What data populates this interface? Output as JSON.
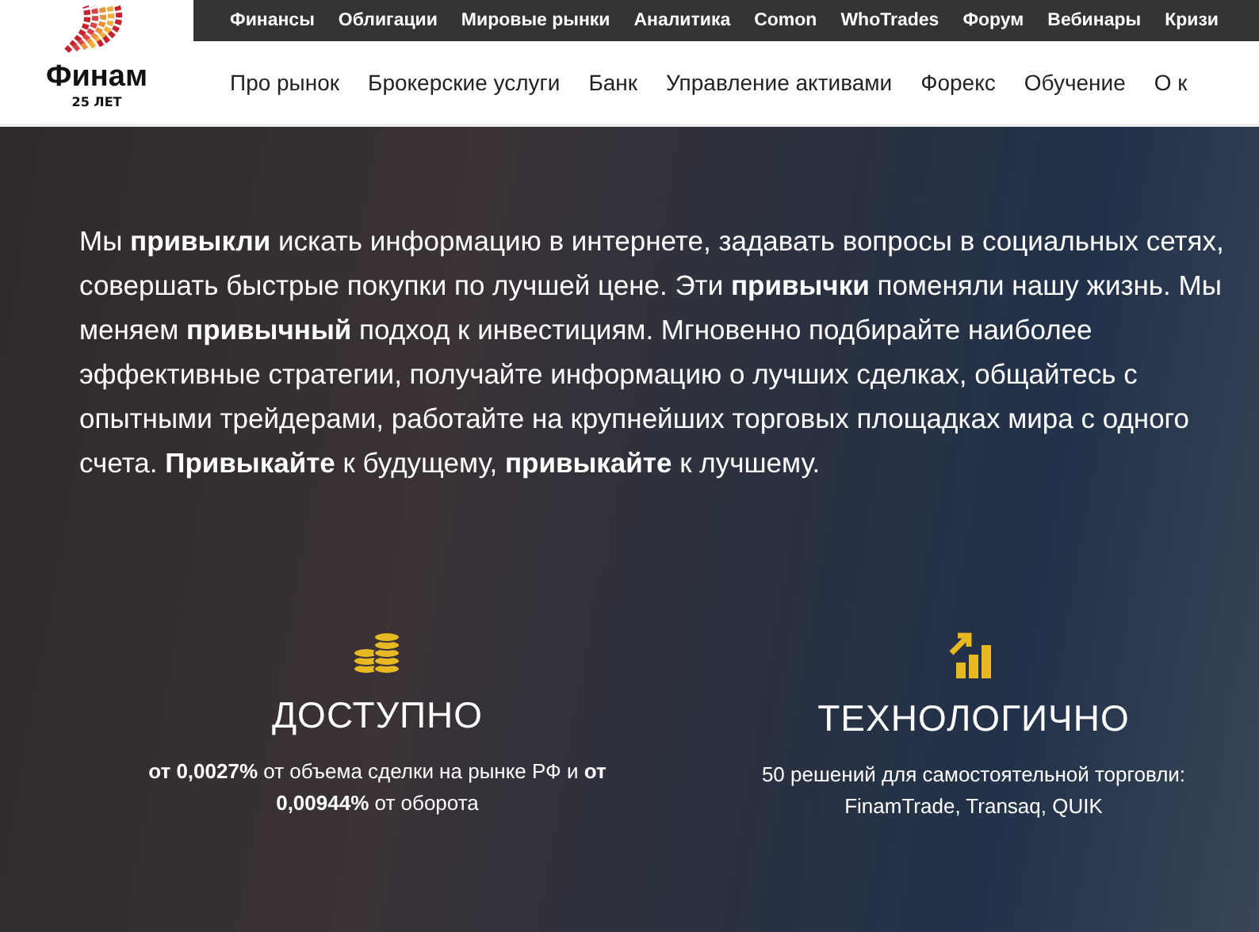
{
  "logo": {
    "name": "Финам",
    "tagline": "25 ЛЕТ"
  },
  "top_nav": [
    "Финансы",
    "Облигации",
    "Мировые рынки",
    "Аналитика",
    "Comon",
    "WhoTrades",
    "Форум",
    "Вебинары",
    "Кризи"
  ],
  "main_nav": [
    "Про рынок",
    "Брокерские услуги",
    "Банк",
    "Управление активами",
    "Форекс",
    "Обучение",
    "О к"
  ],
  "intro": "Мы **привыкли** искать информацию в интернете, задавать вопросы в социальных сетях, совершать быстрые покупки по лучшей цене. Эти **привычки** поменяли нашу жизнь. Мы меняем **привычный** подход к инвестициям. Мгновенно подбирайте наиболее эффективные стратегии, получайте информацию о лучших сделках, общайтесь с опытными трейдерами, работайте на крупнейших торговых площадках мира с одного счета. **Привыкайте** к будущему, **привыкайте** к лучшему.",
  "features": [
    {
      "kind": "coins",
      "title": "ДОСТУПНО",
      "text": "**от 0,0027%** от объема сделки на рынке РФ и **от 0,00944%** от оборота"
    },
    {
      "kind": "chart",
      "title": "ТЕХНОЛОГИЧНО",
      "text": "50 решений для самостоятельной торговли: FinamTrade, Transaq, QUIK"
    }
  ]
}
